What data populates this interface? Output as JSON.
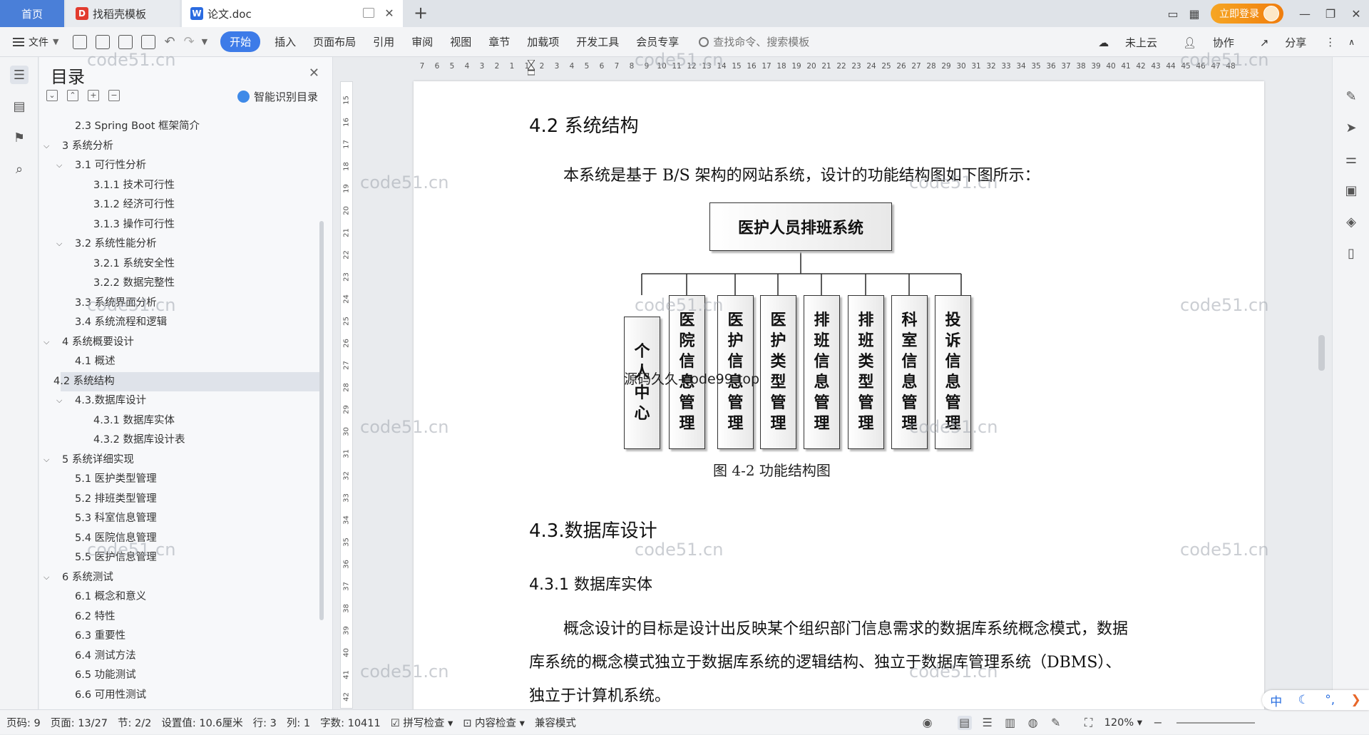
{
  "tabs": {
    "home": "首页",
    "daoke": "找稻壳模板",
    "doc": "论文.doc"
  },
  "titlebar": {
    "login": "立即登录"
  },
  "ribbon": {
    "file": "文件",
    "items": [
      "开始",
      "插入",
      "页面布局",
      "引用",
      "审阅",
      "视图",
      "章节",
      "加载项",
      "开发工具",
      "会员专享"
    ],
    "search_placeholder": "查找命令、搜索模板",
    "cloud": "未上云",
    "collab": "协作",
    "share": "分享"
  },
  "toc": {
    "title": "目录",
    "smart": "智能识别目录",
    "items": [
      {
        "text": "2.3 Spring Boot 框架简介",
        "level": 2
      },
      {
        "text": "3 系统分析",
        "level": 1
      },
      {
        "text": "3.1 可行性分析",
        "level": 2
      },
      {
        "text": "3.1.1 技术可行性",
        "level": 3
      },
      {
        "text": "3.1.2 经济可行性",
        "level": 3
      },
      {
        "text": "3.1.3 操作可行性",
        "level": 3
      },
      {
        "text": "3.2 系统性能分析",
        "level": 2
      },
      {
        "text": "3.2.1  系统安全性",
        "level": 3
      },
      {
        "text": "3.2.2  数据完整性",
        "level": 3
      },
      {
        "text": "3.3 系统界面分析",
        "level": 2
      },
      {
        "text": "3.4 系统流程和逻辑",
        "level": 2
      },
      {
        "text": "4 系统概要设计",
        "level": 1
      },
      {
        "text": "4.1 概述",
        "level": 2
      },
      {
        "text": "4.2 系统结构",
        "level": 2
      },
      {
        "text": "4.3.数据库设计",
        "level": 2
      },
      {
        "text": "4.3.1 数据库实体",
        "level": 3
      },
      {
        "text": "4.3.2 数据库设计表",
        "level": 3
      },
      {
        "text": "5 系统详细实现",
        "level": 1
      },
      {
        "text": "5.1  医护类型管理",
        "level": 2
      },
      {
        "text": "5.2  排班类型管理",
        "level": 2
      },
      {
        "text": "5.3  科室信息管理",
        "level": 2
      },
      {
        "text": "5.4  医院信息管理",
        "level": 2
      },
      {
        "text": "5.5  医护信息管理",
        "level": 2
      },
      {
        "text": "6 系统测试",
        "level": 1
      },
      {
        "text": "6.1 概念和意义",
        "level": 2
      },
      {
        "text": "6.2 特性",
        "level": 2
      },
      {
        "text": "6.3 重要性",
        "level": 2
      },
      {
        "text": "6.4 测试方法",
        "level": 2
      },
      {
        "text": "6.5  功能测试",
        "level": 2
      },
      {
        "text": "6.6 可用性测试",
        "level": 2
      }
    ]
  },
  "hruler": [
    "7",
    "6",
    "5",
    "4",
    "3",
    "2",
    "1",
    "1",
    "2",
    "3",
    "4",
    "5",
    "6",
    "7",
    "8",
    "9",
    "10",
    "11",
    "12",
    "13",
    "14",
    "15",
    "16",
    "17",
    "18",
    "19",
    "20",
    "21",
    "22",
    "23",
    "24",
    "25",
    "26",
    "27",
    "28",
    "29",
    "30",
    "31",
    "32",
    "33",
    "34",
    "35",
    "36",
    "37",
    "38",
    "39",
    "40",
    "41",
    "42",
    "43",
    "44",
    "45",
    "46",
    "47",
    "48"
  ],
  "vruler": [
    "15",
    "16",
    "17",
    "18",
    "19",
    "20",
    "21",
    "22",
    "23",
    "24",
    "25",
    "26",
    "27",
    "28",
    "29",
    "30",
    "31",
    "32",
    "33",
    "34",
    "35",
    "36",
    "37",
    "38",
    "39",
    "40",
    "41",
    "42"
  ],
  "document": {
    "h_42": "4.2 系统结构",
    "p1": "本系统是基于 B/S 架构的网站系统，设计的功能结构图如下图所示：",
    "diagram_root": "医护人员排班系统",
    "diagram_leaves": [
      "个人中心",
      "医院信息管理",
      "医护信息管理",
      "医护类型管理",
      "排班信息管理",
      "排班类型管理",
      "科室信息管理",
      "投诉信息管理"
    ],
    "caption": "图 4-2 功能结构图",
    "h_43": "4.3.数据库设计",
    "h_431": "4.3.1 数据库实体",
    "p2_line1": "概念设计的目标是设计出反映某个组织部门信息需求的数据库系统概念模式，数据",
    "p2_line2": "库系统的概念模式独立于数据库系统的逻辑结构、独立于数据库管理系统（DBMS）、",
    "p2_line3": "独立于计算机系统。"
  },
  "watermark": "code51.cn",
  "watermark2": "源码久久-code99.top",
  "status": {
    "page": "页码: 9",
    "pages": "页面: 13/27",
    "section": "节: 2/2",
    "setting": "设置值: 10.6厘米",
    "row": "行: 3",
    "col": "列: 1",
    "words": "字数: 10411",
    "spell": "拼写检查",
    "content": "内容检查",
    "compat": "兼容模式",
    "zoom": "120%"
  },
  "ime": {
    "lang": "中"
  },
  "colors": {
    "accent": "#3d7be8",
    "login": "#f08a14",
    "watermark": "#a0a5af"
  }
}
